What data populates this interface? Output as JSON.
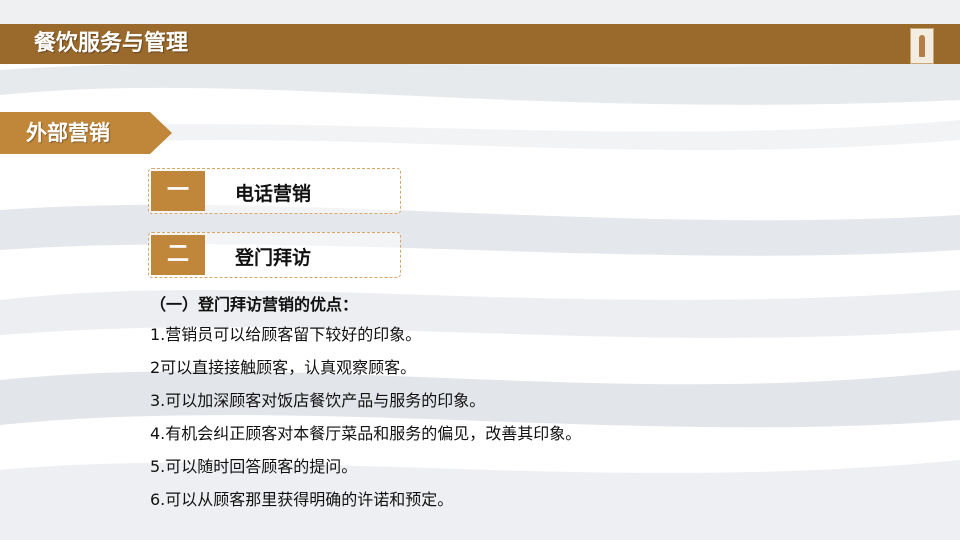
{
  "header": {
    "title": "餐饮服务与管理"
  },
  "section": {
    "label": "外部营销"
  },
  "items": [
    {
      "number": "一",
      "label": "电话营销"
    },
    {
      "number": "二",
      "label": "登门拜访"
    }
  ],
  "content": {
    "heading": "（一）登门拜访营销的优点：",
    "lines": [
      "1.营销员可以给顾客留下较好的印象。",
      "2可以直接接触顾客，认真观察顾客。",
      "3.可以加深顾客对饭店餐饮产品与服务的印象。",
      "4.有机会纠正顾客对本餐厅菜品和服务的偏见，改善其印象。",
      "5.可以随时回答顾客的提问。",
      "6.可以从顾客那里获得明确的许诺和预定。"
    ]
  },
  "colors": {
    "title_bar": "#9a6a2c",
    "accent": "#c0873b",
    "text": "#111111"
  },
  "icons": {
    "thumbnail": "figure-thumbnail-icon"
  }
}
